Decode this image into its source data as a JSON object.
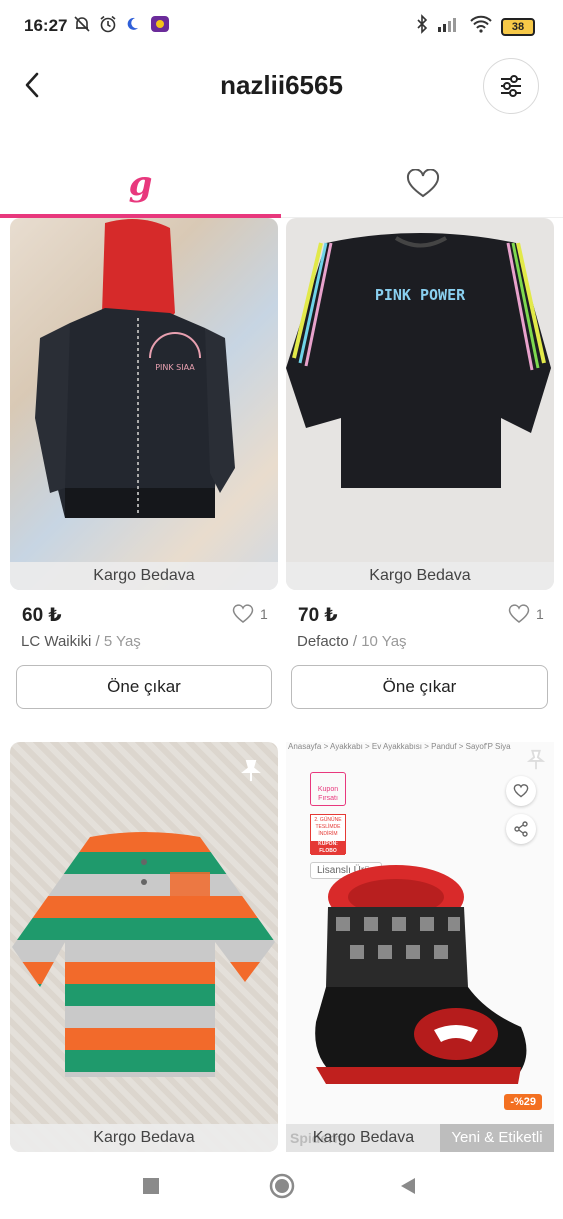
{
  "status_bar": {
    "time": "16:27",
    "battery": "38"
  },
  "header": {
    "title": "nazlii6565"
  },
  "tabs": {
    "closet_logo": "g"
  },
  "products": [
    {
      "shipping": "Kargo Bedava",
      "price": "60 ₺",
      "likes": "1",
      "brand": "LC Waikiki",
      "separator": "/",
      "size": "5 Yaş",
      "promote": "Öne çıkar"
    },
    {
      "shipping": "Kargo Bedava",
      "price": "70 ₺",
      "likes": "1",
      "brand": "Defacto",
      "separator": "/",
      "size": "10 Yaş",
      "promote": "Öne çıkar"
    },
    {
      "shipping": "Kargo Bedava"
    },
    {
      "shipping": "Kargo Bedava",
      "tag_new": "Yeni & Etiketli",
      "breadcrumb": "Anasayfa > Ayakkabı > Ev Ayakkabısı > Panduf > Sayof'P Siya",
      "coupon_label": "Kupon Fırsatı",
      "delivery_label": "2. GÜNÜNE TESLİMDE İNDİRİM",
      "coupon_code": "KUPON: FLOBO",
      "licensed_label": "Lisanslı Ürün",
      "discount": "-%29",
      "watermark": "Spidermen"
    }
  ],
  "product_art": {
    "sweat_print": "PINK POWER",
    "jacket_print": "PINK SIAA"
  },
  "colors": {
    "accent": "#e8387d"
  }
}
